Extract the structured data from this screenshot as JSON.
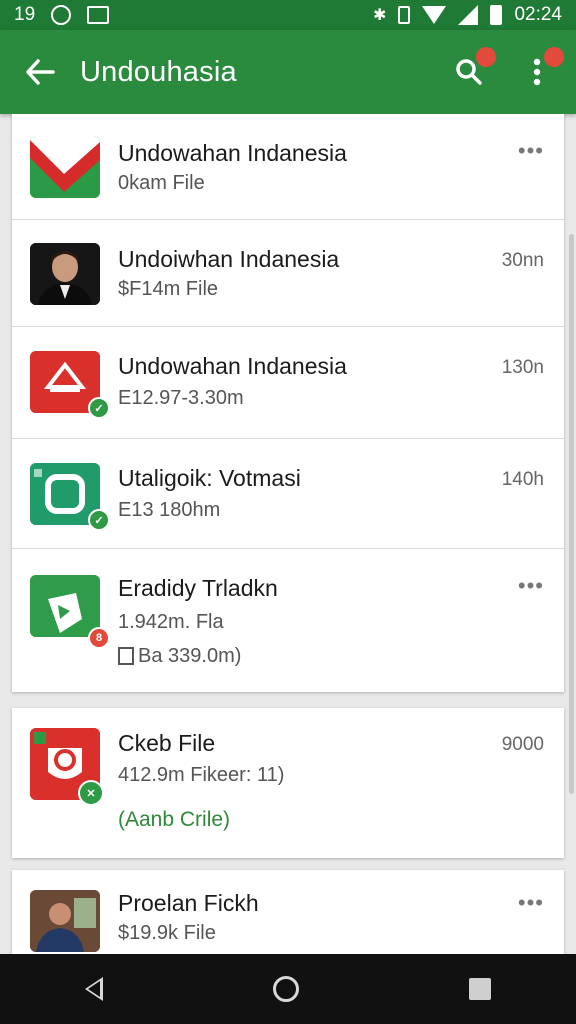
{
  "status": {
    "left_time": "19",
    "right_time": "02:24"
  },
  "appbar": {
    "title": "Undouhasia"
  },
  "items": [
    {
      "title": "Undowahan Indanesia",
      "sub": "0kam File",
      "meta": "•••"
    },
    {
      "title": "Undoiwhan Indanesia",
      "sub": "$F14m File",
      "meta": "30nn"
    },
    {
      "title": "Undowahan Indanesia",
      "sub": "E12.97-3.30m",
      "meta": "130n"
    },
    {
      "title": "Utaligoik: Votmasi",
      "sub": "E13 180hm",
      "meta": "140h"
    },
    {
      "title": "Eradidy Trladkn",
      "sub": "1.942m. Fla",
      "sub2": "Ba 339.0m)",
      "meta": "•••"
    }
  ],
  "card2": {
    "title": "Ckeb File",
    "sub": "412.9m Fikeer: 11)",
    "link": "(Aanb Crile)",
    "meta": "9000"
  },
  "card3": {
    "title": "Proelan Fickh",
    "sub": "$19.9k File",
    "meta": "•••"
  },
  "colors": {
    "accent": "#2a8a3e",
    "status": "#1e7a34",
    "link": "#2e8a3a"
  }
}
